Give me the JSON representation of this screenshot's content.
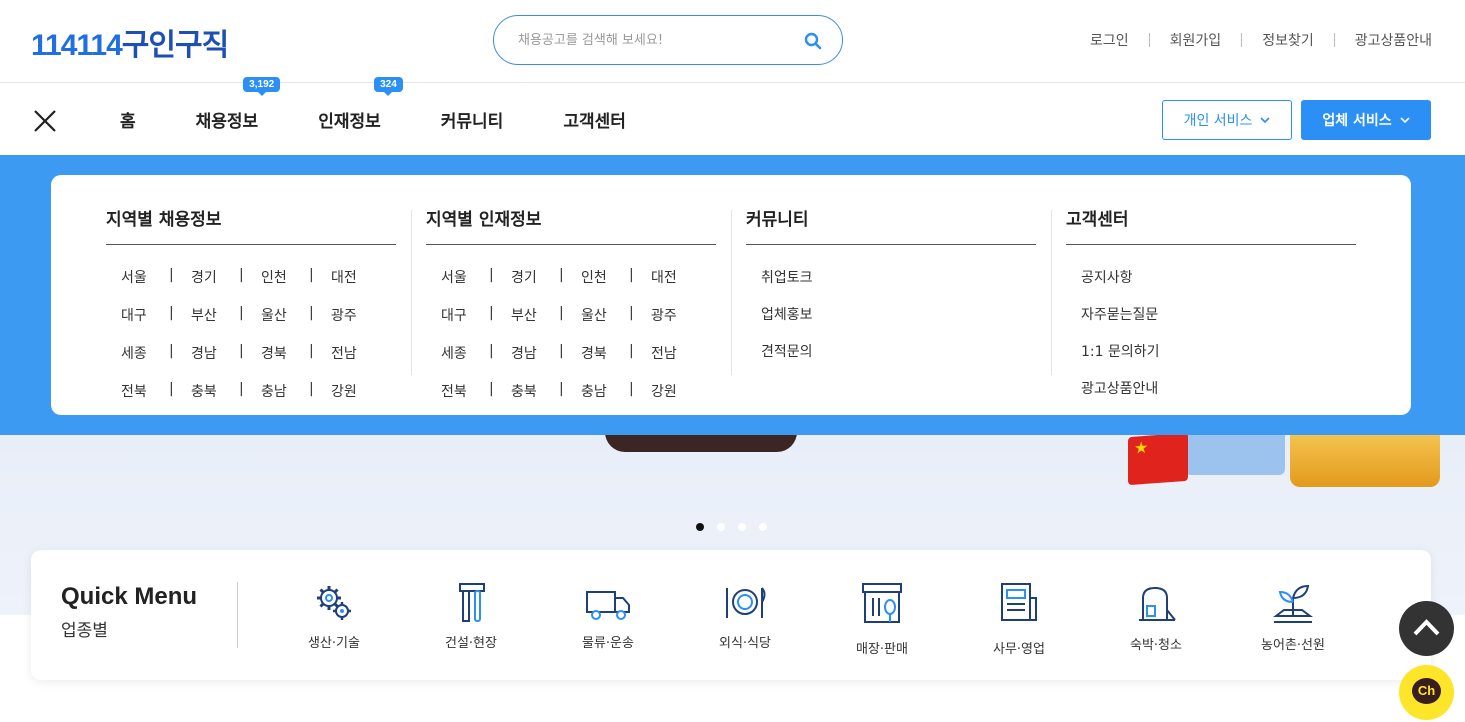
{
  "header": {
    "logo_num": "114114",
    "logo_text": "구인구직",
    "search_placeholder": "채용공고를 검색해 보세요!",
    "util_links": [
      "로그인",
      "회원가입",
      "정보찾기",
      "광고상품안내"
    ]
  },
  "nav": {
    "items": [
      {
        "label": "홈",
        "badge": ""
      },
      {
        "label": "채용정보",
        "badge": "3,192"
      },
      {
        "label": "인재정보",
        "badge": "324"
      },
      {
        "label": "커뮤니티",
        "badge": ""
      },
      {
        "label": "고객센터",
        "badge": ""
      }
    ],
    "personal_service": "개인 서비스",
    "company_service": "업체 서비스"
  },
  "mega_menu": {
    "jobs": {
      "title": "지역별 채용정보",
      "regions": [
        "서울",
        "경기",
        "인천",
        "대전",
        "대구",
        "부산",
        "울산",
        "광주",
        "세종",
        "경남",
        "경북",
        "전남",
        "전북",
        "충북",
        "충남",
        "강원"
      ]
    },
    "talent": {
      "title": "지역별 인재정보",
      "regions": [
        "서울",
        "경기",
        "인천",
        "대전",
        "대구",
        "부산",
        "울산",
        "광주",
        "세종",
        "경남",
        "경북",
        "전남",
        "전북",
        "충북",
        "충남",
        "강원"
      ]
    },
    "community": {
      "title": "커뮤니티",
      "items": [
        "취업토크",
        "업체홍보",
        "견적문의"
      ]
    },
    "support": {
      "title": "고객센터",
      "items": [
        "공지사항",
        "자주묻는질문",
        "1:1 문의하기",
        "광고상품안내"
      ]
    }
  },
  "slider": {
    "total": 4,
    "active": 1
  },
  "quick_menu": {
    "title": "Quick Menu",
    "subtitle": "업종별",
    "items": [
      {
        "label": "생산·기술",
        "icon": "gears-icon"
      },
      {
        "label": "건설·현장",
        "icon": "hammer-wrench-icon"
      },
      {
        "label": "물류·운송",
        "icon": "truck-icon"
      },
      {
        "label": "외식·식당",
        "icon": "plate-cutlery-icon"
      },
      {
        "label": "매장·판매",
        "icon": "store-icon"
      },
      {
        "label": "사무·영업",
        "icon": "newspaper-icon"
      },
      {
        "label": "숙박·청소",
        "icon": "vacuum-icon"
      },
      {
        "label": "농어촌·선원",
        "icon": "sprout-icon"
      }
    ]
  },
  "chat_label": "Ch",
  "colors": {
    "brand": "#1e4fb5",
    "accent": "#2b8ff5",
    "menu_bg": "#3c9af3"
  }
}
